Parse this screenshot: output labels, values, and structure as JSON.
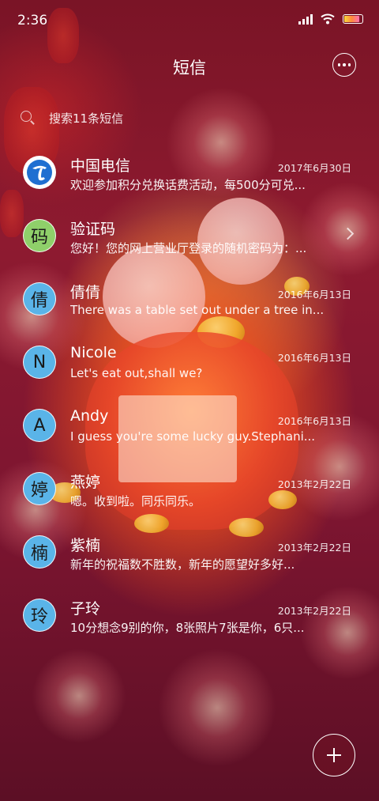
{
  "status_bar": {
    "time": "2:36",
    "icons": [
      "signal-icon",
      "wifi-icon",
      "battery-icon"
    ]
  },
  "header": {
    "title": "短信",
    "more_icon": "more-icon"
  },
  "search": {
    "placeholder": "搜索11条短信",
    "icon": "search-icon"
  },
  "messages": [
    {
      "name": "中国电信",
      "date": "2017年6月30日",
      "preview": "欢迎参加积分兑换话费活动，每500分可兑...",
      "avatar_text": "",
      "avatar_type": "logo",
      "avatar_color": "#1f6fd1"
    },
    {
      "name": "验证码",
      "date": "",
      "preview": "您好！您的网上营业厅登录的随机密码为：...",
      "avatar_text": "码",
      "avatar_type": "letter",
      "avatar_color": "#8fd06a",
      "has_chevron": true
    },
    {
      "name": "倩倩",
      "date": "2016年6月13日",
      "preview": "There was a table set out under a tree in...",
      "avatar_text": "倩",
      "avatar_type": "letter",
      "avatar_color": "#5ab4e8"
    },
    {
      "name": "Nicole",
      "date": "2016年6月13日",
      "preview": "Let's eat out,shall we?",
      "avatar_text": "N",
      "avatar_type": "letter",
      "avatar_color": "#5ab4e8"
    },
    {
      "name": "Andy",
      "date": "2016年6月13日",
      "preview": "I guess you're some lucky guy.Stephani...",
      "avatar_text": "A",
      "avatar_type": "letter",
      "avatar_color": "#5ab4e8"
    },
    {
      "name": "燕婷",
      "date": "2013年2月22日",
      "preview": "嗯。收到啦。同乐同乐。",
      "avatar_text": "婷",
      "avatar_type": "letter",
      "avatar_color": "#5ab4e8"
    },
    {
      "name": "紫楠",
      "date": "2013年2月22日",
      "preview": "新年的祝福数不胜数，新年的愿望好多好...",
      "avatar_text": "楠",
      "avatar_type": "letter",
      "avatar_color": "#5ab4e8"
    },
    {
      "name": "子玲",
      "date": "2013年2月22日",
      "preview": "10分想念9别的你，8张照片7张是你，6只...",
      "avatar_text": "玲",
      "avatar_type": "letter",
      "avatar_color": "#5ab4e8"
    }
  ],
  "fab": {
    "icon": "plus-icon"
  }
}
